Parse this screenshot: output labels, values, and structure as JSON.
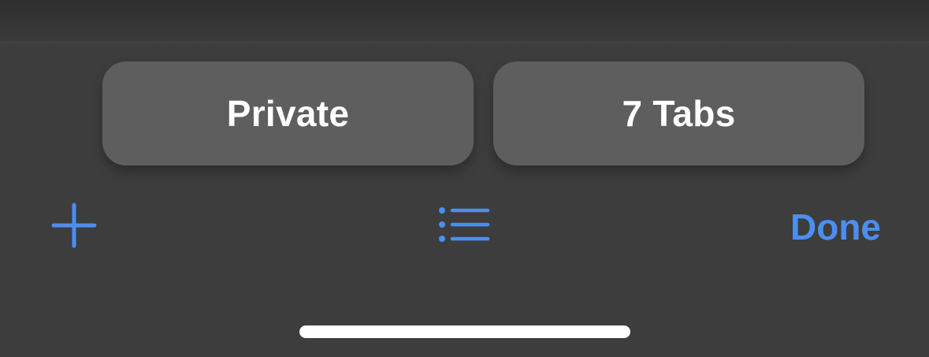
{
  "segments": {
    "private_label": "Private",
    "tabs_label": "7 Tabs"
  },
  "toolbar": {
    "add_icon": "plus-icon",
    "list_icon": "list-icon",
    "done_label": "Done",
    "accent_color": "#4a8ff0"
  },
  "colors": {
    "background": "#3d3d3d",
    "segment_fill": "#5e5e5e",
    "segment_text": "#ffffff",
    "home_indicator": "#ffffff"
  }
}
